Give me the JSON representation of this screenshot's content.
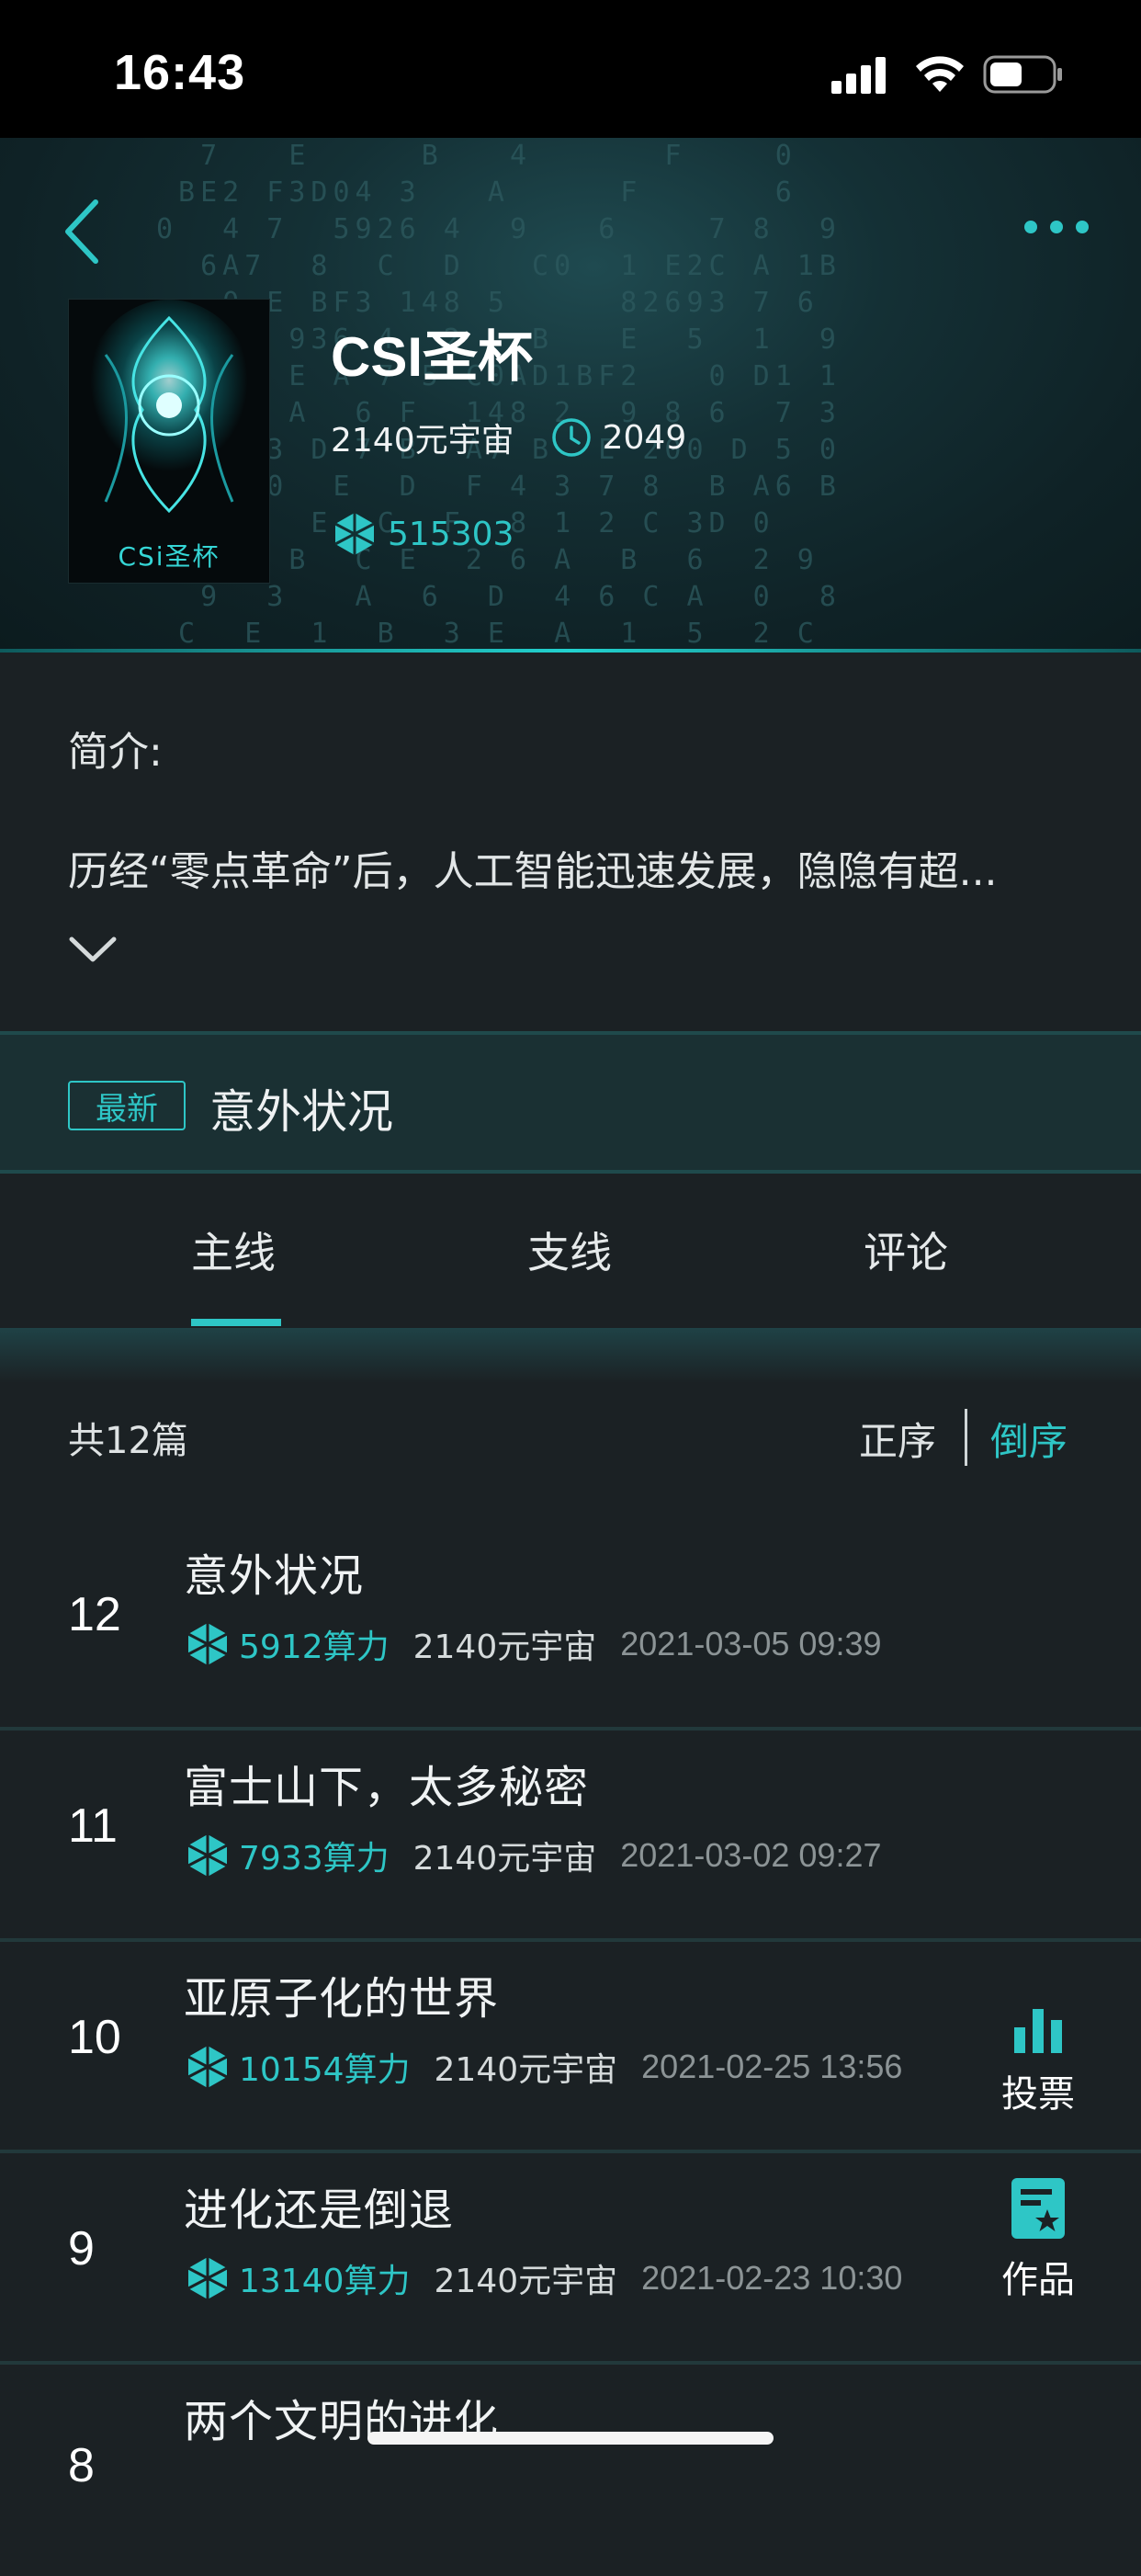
{
  "status_bar": {
    "time": "16:43"
  },
  "book": {
    "title": "CSI圣杯",
    "cover_text": "CSi圣杯",
    "universe": "2140元宇宙",
    "year": "2049",
    "power": "515303"
  },
  "intro": {
    "label": "简介:",
    "text": "历经“零点革命”后，人工智能迅速发展，隐隐有超..."
  },
  "latest": {
    "badge": "最新",
    "title": "意外状况"
  },
  "tabs": [
    {
      "label": "主线",
      "active": true
    },
    {
      "label": "支线",
      "active": false
    },
    {
      "label": "评论",
      "active": false
    }
  ],
  "list_header": {
    "count": "共12篇",
    "sort_asc": "正序",
    "sort_desc": "倒序",
    "active_sort": "desc"
  },
  "chapters": [
    {
      "num": "12",
      "title": "意外状况",
      "power": "5912算力",
      "universe": "2140元宇宙",
      "date": "2021-03-05 09:39"
    },
    {
      "num": "11",
      "title": "富士山下，太多秘密",
      "power": "7933算力",
      "universe": "2140元宇宙",
      "date": "2021-03-02 09:27"
    },
    {
      "num": "10",
      "title": "亚原子化的世界",
      "power": "10154算力",
      "universe": "2140元宇宙",
      "date": "2021-02-25 13:56"
    },
    {
      "num": "9",
      "title": "进化还是倒退",
      "power": "13140算力",
      "universe": "2140元宇宙",
      "date": "2021-02-23 10:30"
    },
    {
      "num": "8",
      "title": "两个文明的进化",
      "power": "",
      "universe": "",
      "date": ""
    }
  ],
  "side_actions": {
    "vote": "投票",
    "works": "作品"
  },
  "colors": {
    "accent": "#2ec6c6",
    "background": "#1b2124",
    "latest_bg": "#1a3033"
  }
}
